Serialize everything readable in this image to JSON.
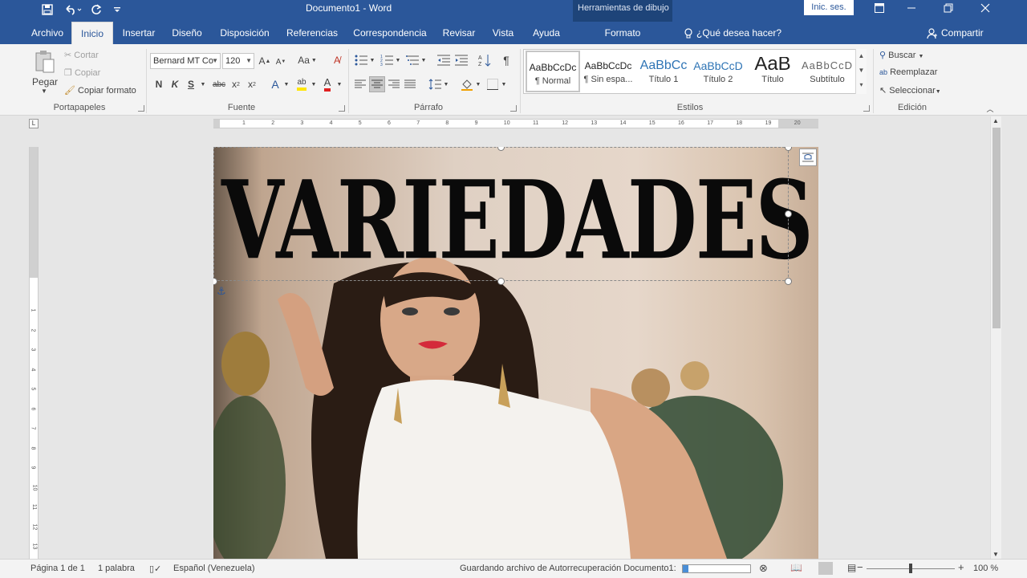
{
  "window": {
    "doc_title": "Documento1  -  Word",
    "contextual_title": "Herramientas de dibujo",
    "sign_in": "Inic. ses.",
    "accent": "#2b579a"
  },
  "tabs": [
    {
      "label": "Archivo"
    },
    {
      "label": "Inicio",
      "active": true
    },
    {
      "label": "Insertar"
    },
    {
      "label": "Diseño"
    },
    {
      "label": "Disposición"
    },
    {
      "label": "Referencias"
    },
    {
      "label": "Correspondencia"
    },
    {
      "label": "Revisar"
    },
    {
      "label": "Vista"
    },
    {
      "label": "Ayuda"
    },
    {
      "label": "Formato"
    }
  ],
  "tell_me": "¿Qué desea hacer?",
  "share": "Compartir",
  "clipboard": {
    "paste": "Pegar",
    "cut": "Cortar",
    "copy": "Copiar",
    "format_painter": "Copiar formato",
    "label": "Portapapeles"
  },
  "font": {
    "name": "Bernard MT Co",
    "size": "120",
    "bold": "N",
    "italic": "K",
    "underline": "S",
    "strike": "abc",
    "change_case": "Aa",
    "label": "Fuente"
  },
  "paragraph": {
    "label": "Párrafo",
    "pilcrow": "¶"
  },
  "styles": {
    "items": [
      {
        "preview": "AaBbCcDc",
        "name": "¶ Normal"
      },
      {
        "preview": "AaBbCcDc",
        "name": "¶ Sin espa..."
      },
      {
        "preview": "AaBbCc",
        "name": "Título 1"
      },
      {
        "preview": "AaBbCcD",
        "name": "Título 2"
      },
      {
        "preview": "AaB",
        "name": "Título"
      },
      {
        "preview": "AaBbCcD",
        "name": "Subtítulo"
      }
    ],
    "label": "Estilos"
  },
  "editing": {
    "find": "Buscar",
    "replace": "Reemplazar",
    "select": "Seleccionar",
    "label": "Edición"
  },
  "document": {
    "wordart_text": "VARIEDADES"
  },
  "ruler": {
    "h_ticks": [
      "1",
      "2",
      "3",
      "4",
      "5",
      "6",
      "7",
      "8",
      "9",
      "10",
      "11",
      "12",
      "13",
      "14",
      "15",
      "16",
      "17",
      "18",
      "19",
      "20"
    ],
    "v_ticks": [
      "1",
      "2",
      "3",
      "4",
      "5",
      "6",
      "7",
      "8",
      "9",
      "10",
      "11",
      "12",
      "13",
      "14"
    ]
  },
  "status": {
    "page": "Página 1 de 1",
    "words": "1 palabra",
    "language": "Español (Venezuela)",
    "autosave": "Guardando archivo de Autorrecuperación Documento1:",
    "zoom": "100 %",
    "zoom_minus": "−",
    "zoom_plus": "+"
  }
}
